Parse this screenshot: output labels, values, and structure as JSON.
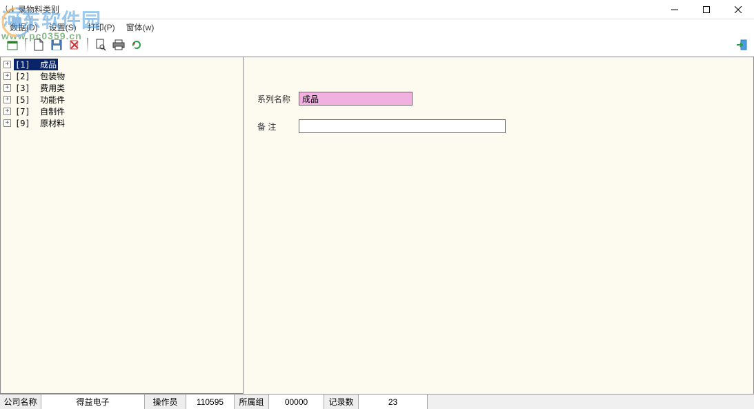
{
  "window": {
    "title": "录物料类别"
  },
  "menubar": {
    "data": "数据(D)",
    "settings": "设置(S)",
    "print": "打印(P)",
    "window": "窗体(w)"
  },
  "watermark": {
    "text": "河东软件园",
    "url": "www.pc0359.cn"
  },
  "tree": {
    "items": [
      {
        "code": "[1]",
        "name": "成品",
        "selected": true
      },
      {
        "code": "[2]",
        "name": "包装物",
        "selected": false
      },
      {
        "code": "[3]",
        "name": "费用类",
        "selected": false
      },
      {
        "code": "[5]",
        "name": "功能件",
        "selected": false
      },
      {
        "code": "[7]",
        "name": "自制件",
        "selected": false
      },
      {
        "code": "[9]",
        "name": "原材料",
        "selected": false
      }
    ]
  },
  "form": {
    "series_label": "系列名称",
    "series_value": "成品",
    "remark_label": "备    注",
    "remark_value": ""
  },
  "statusbar": {
    "company_label": "公司名称",
    "company_value": "得益电子",
    "operator_label": "操作员",
    "operator_value": "110595",
    "group_label": "所属组",
    "group_value": "00000",
    "records_label": "记录数",
    "records_value": "23"
  },
  "icons": {
    "new": "new-icon",
    "open": "open-icon",
    "save": "save-icon",
    "delete": "delete-icon",
    "preview": "preview-icon",
    "print": "print-icon",
    "refresh": "refresh-icon",
    "exit": "exit-icon"
  }
}
